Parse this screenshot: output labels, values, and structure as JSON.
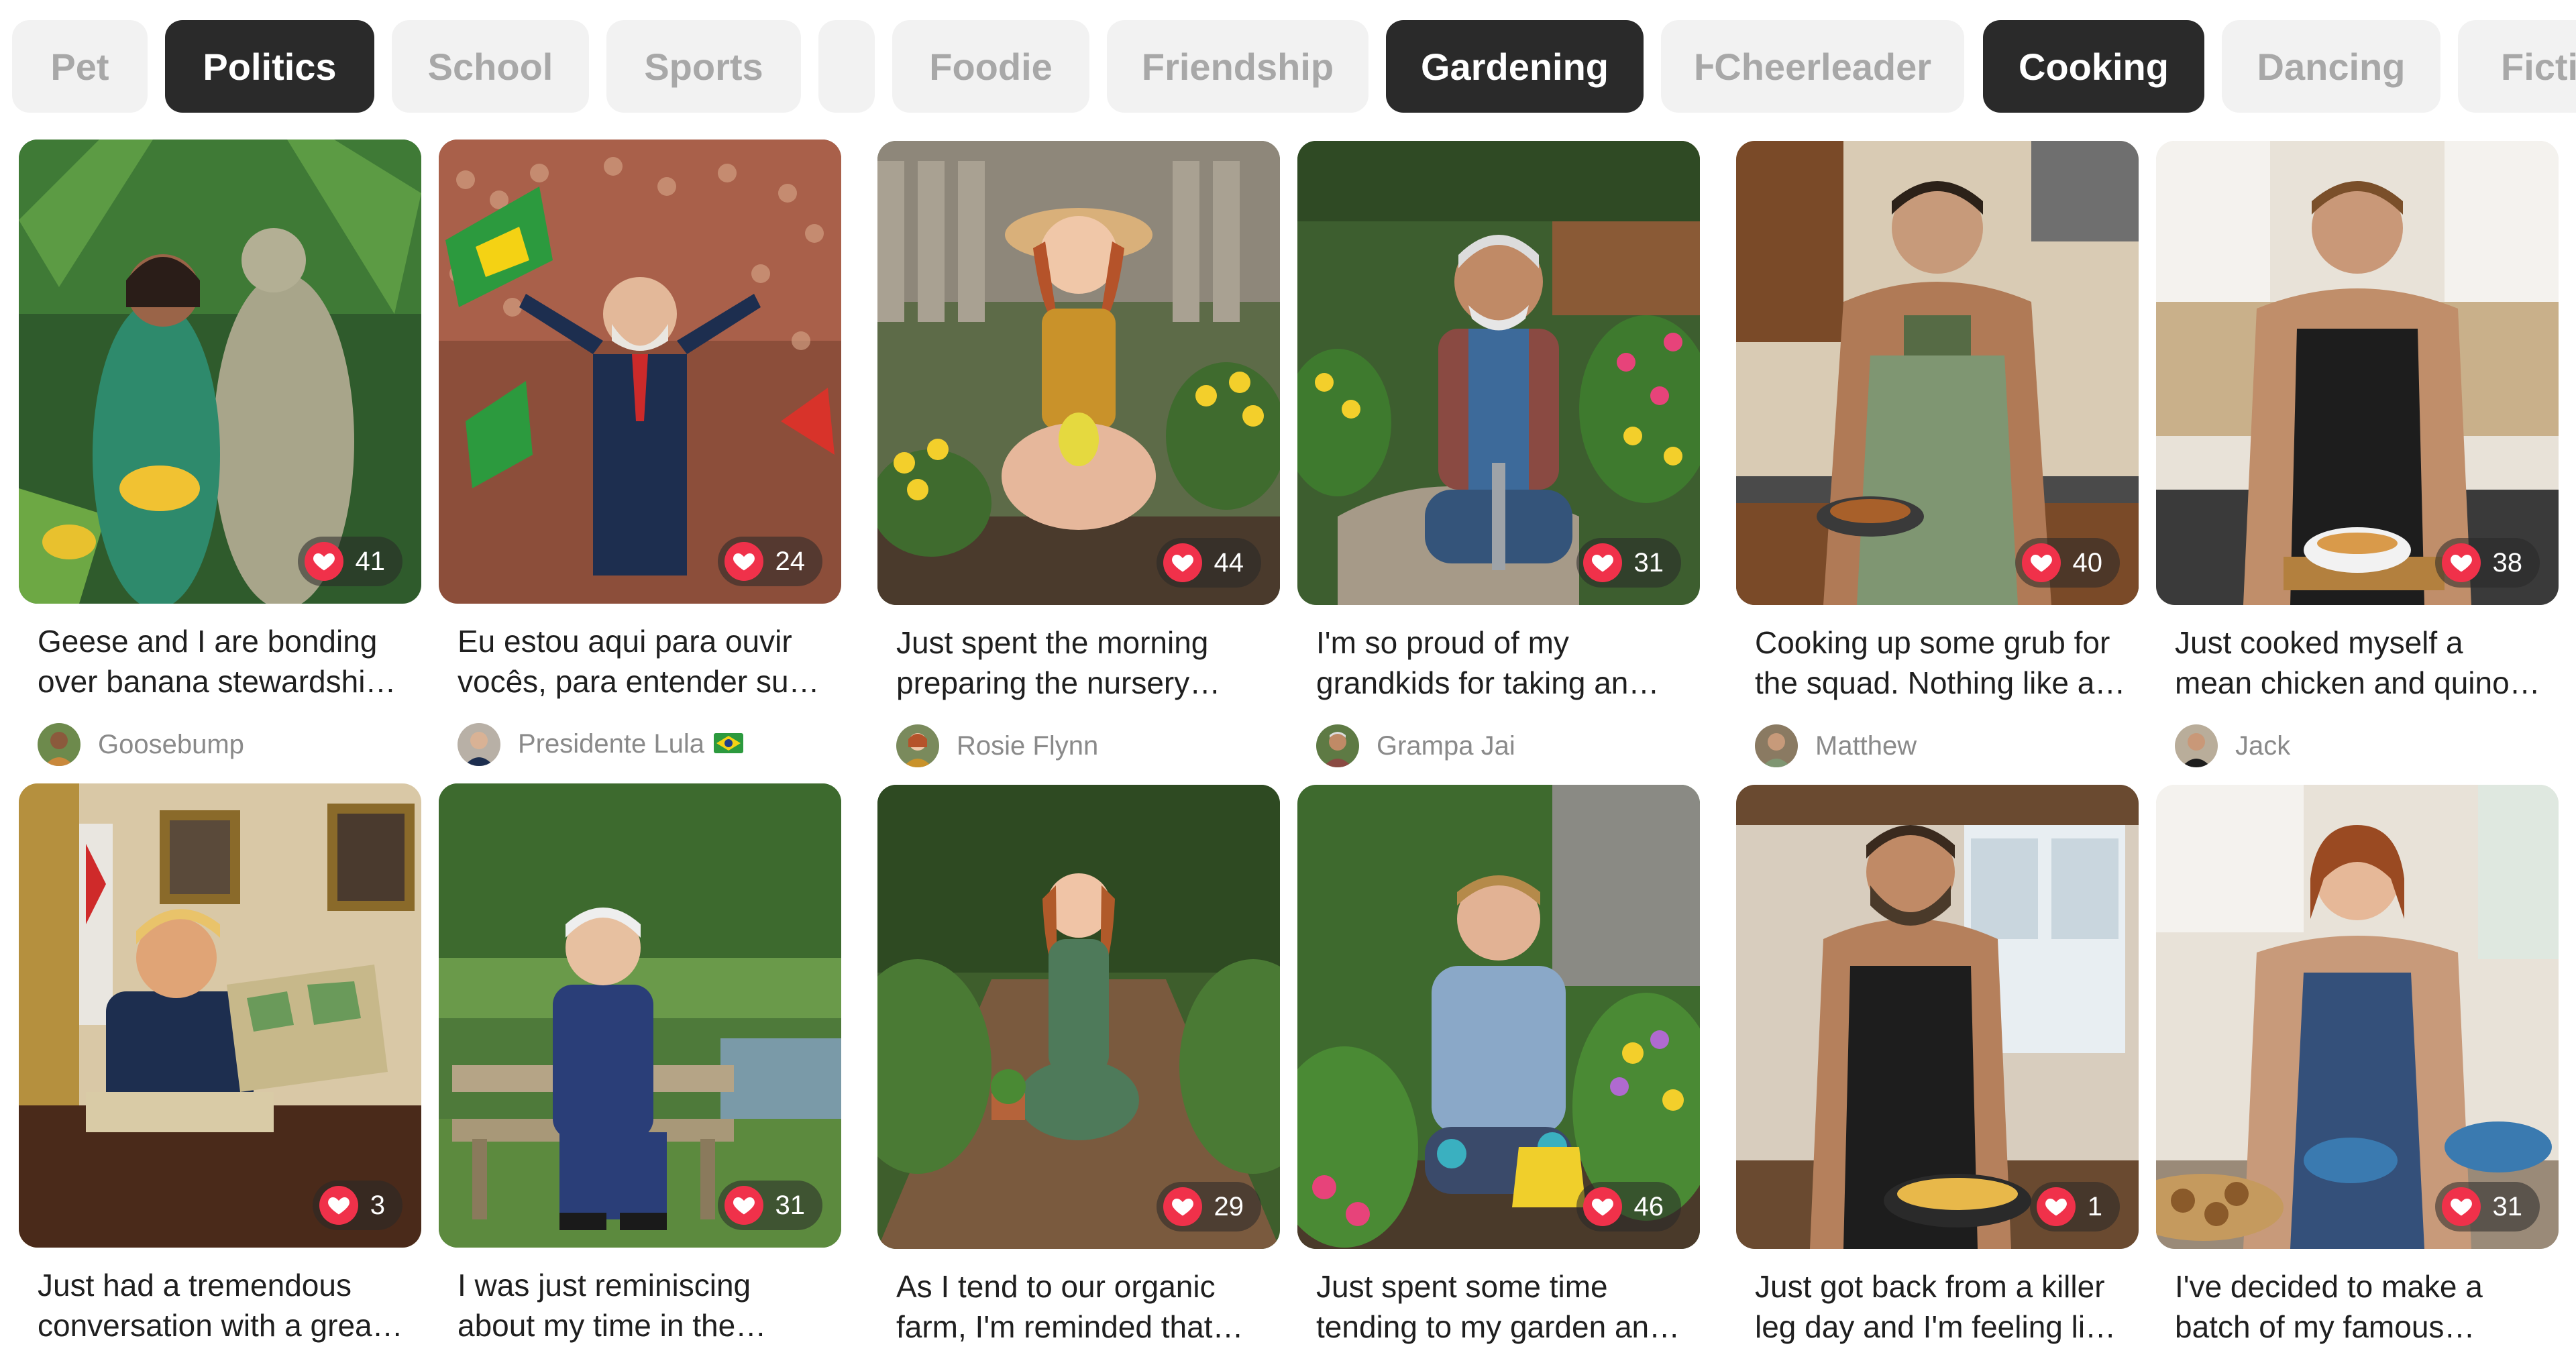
{
  "categories": [
    {
      "label": "Pet",
      "active": false
    },
    {
      "label": "Politics",
      "active": true
    },
    {
      "label": "School",
      "active": false
    },
    {
      "label": "Sports",
      "active": false
    },
    {
      "label": "",
      "active": false
    },
    {
      "label": "Foodie",
      "active": false
    },
    {
      "label": "Friendship",
      "active": false
    },
    {
      "label": "Gardening",
      "active": true
    },
    {
      "label": "ⱵCheerleader",
      "active": false
    },
    {
      "label": "Cooking",
      "active": true
    },
    {
      "label": "Dancing",
      "active": false
    },
    {
      "label": "Ficti",
      "active": false
    }
  ],
  "colors": {
    "chip_active_bg": "#2a2a2a",
    "chip_inactive_bg": "#f2f2f2",
    "like_heart": "#f0314a",
    "caption_text": "#1f1f1f",
    "author_text": "#8a8a8a"
  },
  "icons": {
    "like": "heart-icon",
    "flag": "brazil-flag-icon"
  },
  "posts": [
    {
      "likes": "41",
      "caption": [
        "Geese and I are bonding",
        "over banana stewardshi…"
      ],
      "author": "Goosebump",
      "flag": false
    },
    {
      "likes": "24",
      "caption": [
        "Eu estou aqui para ouvir",
        "vocês, para entender su…"
      ],
      "author": "Presidente Lula",
      "flag": true
    },
    {
      "likes": "44",
      "caption": [
        "Just spent the morning",
        "preparing the nursery…"
      ],
      "author": "Rosie Flynn",
      "flag": false
    },
    {
      "likes": "31",
      "caption": [
        "I'm so proud of my",
        "grandkids for taking an…"
      ],
      "author": "Grampa Jai",
      "flag": false
    },
    {
      "likes": "40",
      "caption": [
        "Cooking up some grub for",
        "the squad. Nothing like a…"
      ],
      "author": "Matthew",
      "flag": false
    },
    {
      "likes": "38",
      "caption": [
        "Just cooked myself a",
        "mean chicken and quino…"
      ],
      "author": "Jack",
      "flag": false
    },
    {
      "likes": "3",
      "caption": [
        "Just had a tremendous",
        "conversation with a grea…"
      ],
      "author": "",
      "flag": false
    },
    {
      "likes": "31",
      "caption": [
        "I was just reminiscing",
        "about my time in the…"
      ],
      "author": "",
      "flag": false
    },
    {
      "likes": "29",
      "caption": [
        "As I tend to our organic",
        "farm, I'm reminded that…"
      ],
      "author": "",
      "flag": false
    },
    {
      "likes": "46",
      "caption": [
        "Just spent some time",
        "tending to my garden an…"
      ],
      "author": "",
      "flag": false
    },
    {
      "likes": "1",
      "caption": [
        "Just got back from a killer",
        "leg day and I'm feeling li…"
      ],
      "author": "",
      "flag": false
    },
    {
      "likes": "31",
      "caption": [
        "I've decided to make a",
        "batch of my famous…"
      ],
      "author": "",
      "flag": false
    }
  ]
}
